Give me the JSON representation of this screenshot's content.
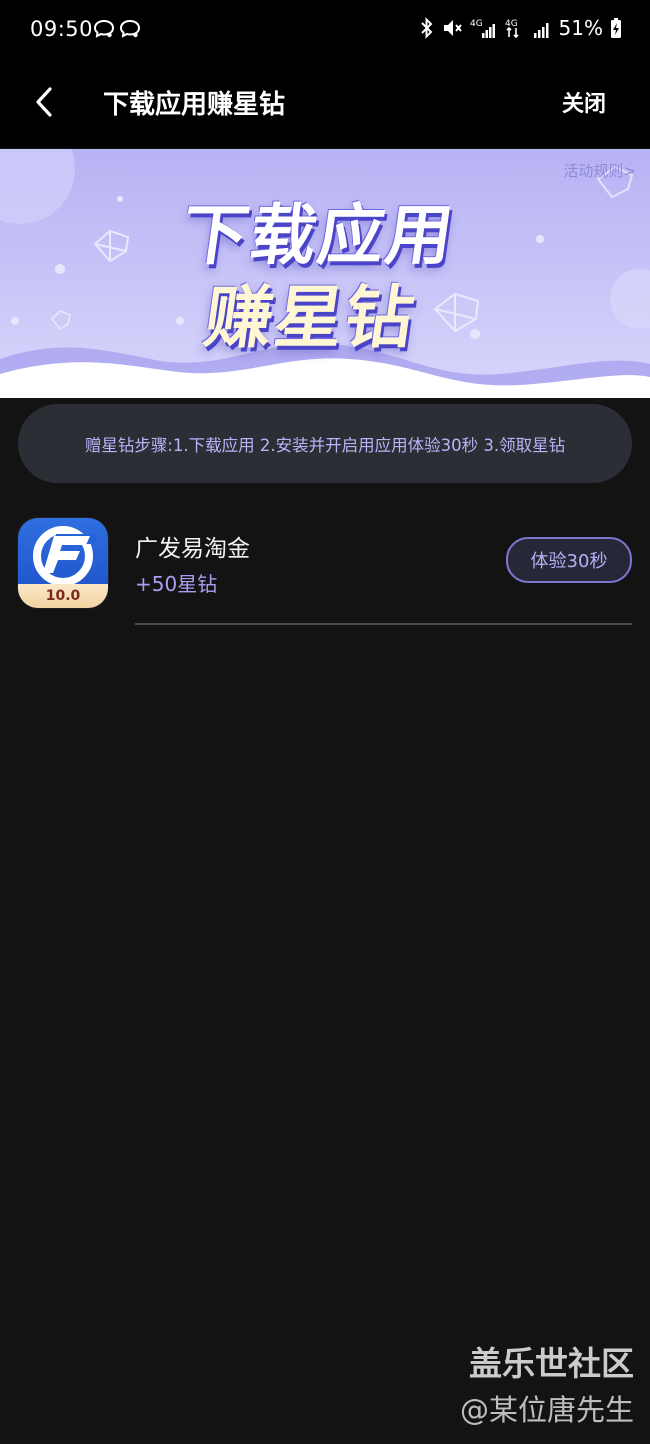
{
  "status_bar": {
    "time": "09:50",
    "battery": "51%",
    "icons": [
      "chat-icon",
      "chat-icon",
      "bluetooth-icon",
      "mute-icon",
      "signal-4g-icon",
      "signal-4g-icon",
      "signal-icon",
      "battery-icon"
    ]
  },
  "header": {
    "title": "下载应用赚星钻",
    "close_label": "关闭",
    "back_icon": "chevron-left-icon"
  },
  "banner": {
    "line1": "下载应用",
    "line2": "赚星钻",
    "rules_link": "活动规则>"
  },
  "steps": {
    "text": "赠星钻步骤:1.下载应用 2.安装并开启用应用体验30秒 3.领取星钻"
  },
  "apps": [
    {
      "name": "广发易淘金",
      "reward": "+50星钻",
      "icon_badge": "10.0",
      "action_label": "体验30秒"
    }
  ],
  "watermark": {
    "line1": "盖乐世社区",
    "line2": "@某位唐先生"
  },
  "colors": {
    "background": "#131313",
    "accent": "#a89ff2",
    "pill": "#2c2e35"
  }
}
